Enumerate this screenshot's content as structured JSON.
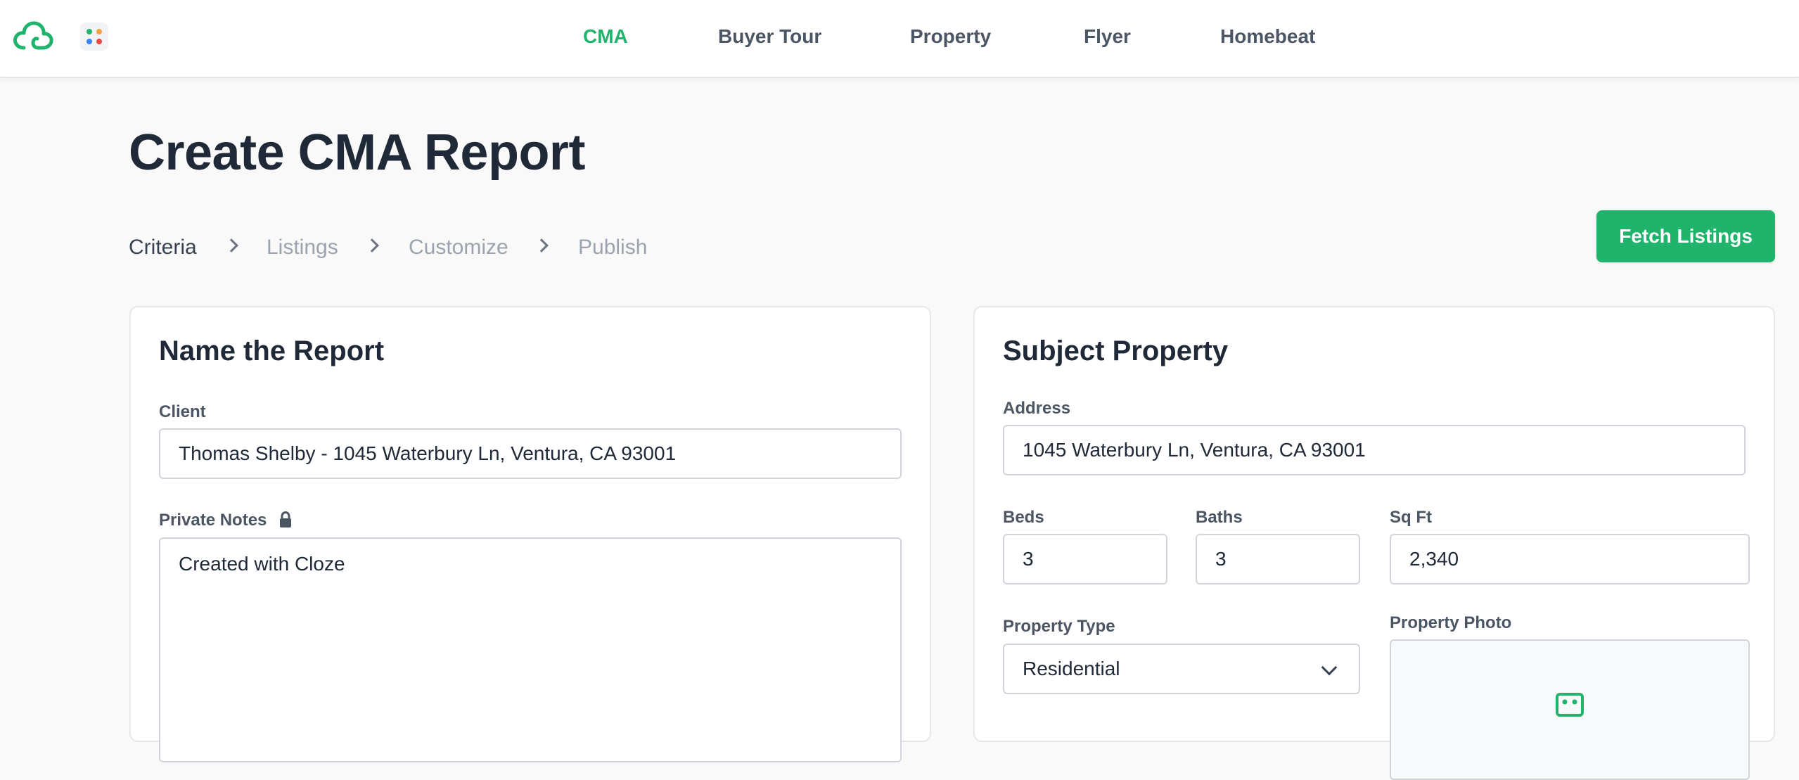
{
  "nav": {
    "items": [
      "CMA",
      "Buyer Tour",
      "Property",
      "Flyer",
      "Homebeat"
    ],
    "active_index": 0
  },
  "icons": {
    "logo": "cloud-logo-icon",
    "apps": "apps-grid-icon",
    "lock": "lock-icon",
    "chevron": "chevron-right-icon",
    "select": "chevron-down-icon",
    "photo": "image-placeholder-icon"
  },
  "colors": {
    "accent": "#1fb36c",
    "text": "#1f2937",
    "muted": "#9ca3af",
    "border": "#d1d5db"
  },
  "page": {
    "title": "Create CMA Report",
    "steps": [
      "Criteria",
      "Listings",
      "Customize",
      "Publish"
    ],
    "current_step": 0,
    "fetch_button": "Fetch Listings"
  },
  "report": {
    "title": "Name the Report",
    "client_label": "Client",
    "client_value": "Thomas Shelby - 1045 Waterbury Ln, Ventura, CA 93001",
    "notes_label": "Private Notes",
    "notes_value": "Created with Cloze"
  },
  "subject": {
    "title": "Subject Property",
    "address_label": "Address",
    "address_value": "1045 Waterbury Ln, Ventura, CA 93001",
    "beds_label": "Beds",
    "beds_value": "3",
    "baths_label": "Baths",
    "baths_value": "3",
    "sqft_label": "Sq Ft",
    "sqft_value": "2,340",
    "type_label": "Property Type",
    "type_value": "Residential",
    "photo_label": "Property Photo"
  }
}
